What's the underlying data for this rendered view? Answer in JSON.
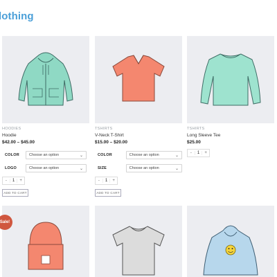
{
  "page": {
    "title": "lothing"
  },
  "colors": {
    "title": "#4a9fd8",
    "sale_badge": "#d0573f",
    "image_bg": "#ecedf1"
  },
  "products": [
    {
      "category": "HOODIES",
      "name": "Hoodie",
      "price": "$42.00 – $45.00",
      "variations": [
        {
          "label": "COLOR",
          "selected": "Choose an option"
        },
        {
          "label": "LOGO",
          "selected": "Choose an option"
        }
      ],
      "quantity": "1",
      "add_to_cart": "ADD TO CART"
    },
    {
      "category": "TSHIRTS",
      "name": "V-Neck T-Shirt",
      "price": "$15.00 – $20.00",
      "variations": [
        {
          "label": "COLOR",
          "selected": "Choose an option"
        },
        {
          "label": "SIZE",
          "selected": "Choose an option"
        }
      ],
      "quantity": "1",
      "add_to_cart": "ADD TO CART"
    },
    {
      "category": "TSHIRTS",
      "name": "Long Sleeve Tee",
      "price": "$25.00",
      "quantity": "1"
    }
  ],
  "sale_badge": "Sale!",
  "row2_items": [
    {
      "icon": "beanie-icon"
    },
    {
      "icon": "tshirt-icon"
    },
    {
      "icon": "hoodie-with-logo-icon"
    }
  ],
  "qty_controls": {
    "minus": "-",
    "plus": "+"
  }
}
